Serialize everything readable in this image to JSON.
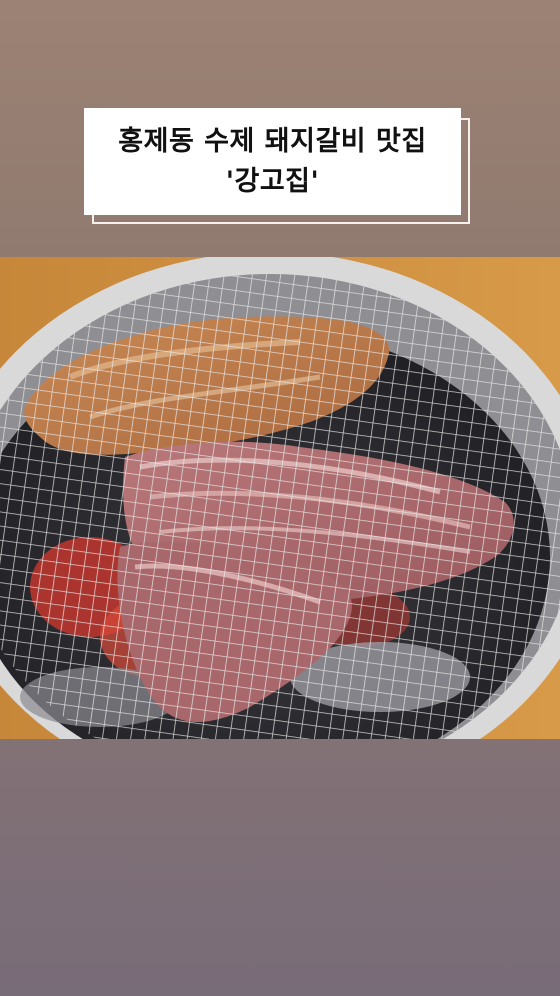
{
  "caption": {
    "line1": "홍제동 수제 돼지갈비 맛집",
    "line2": "'강고집'"
  },
  "photo": {
    "icon": "grilled-meat-photo"
  },
  "colors": {
    "background_top": "#9c8274",
    "background_bottom": "#786c78",
    "caption_bg": "#ffffff",
    "caption_text": "#111111"
  }
}
